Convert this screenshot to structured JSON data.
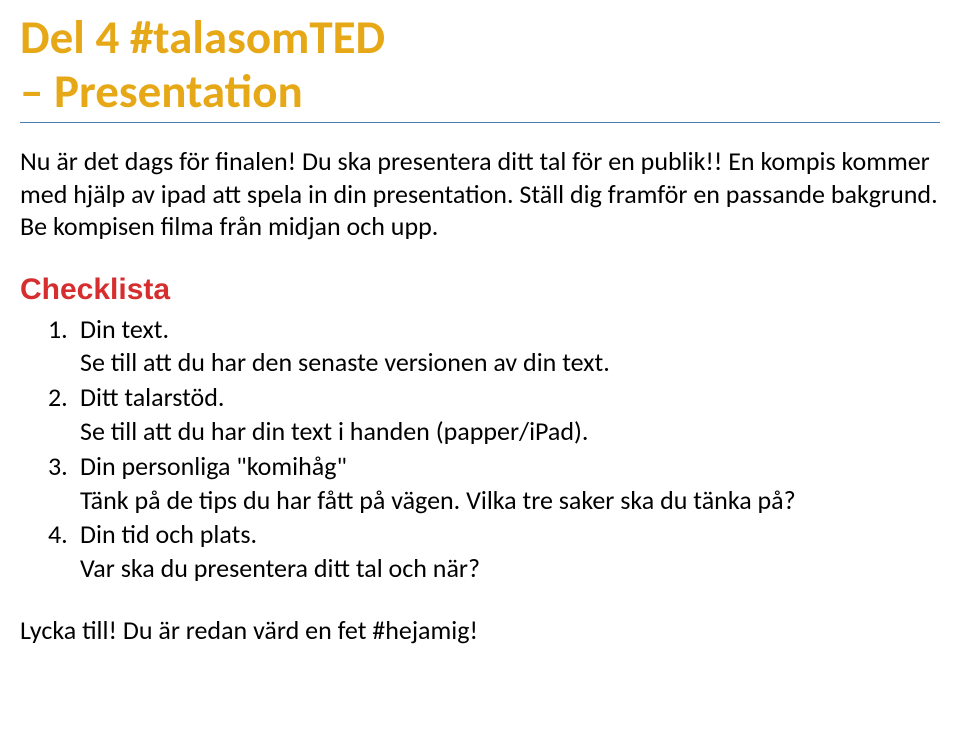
{
  "title": {
    "line1": "Del 4 #talasomTED",
    "line2": "– Presentation"
  },
  "intro": "Nu är det dags för finalen! Du ska presentera ditt tal för en publik!! En kompis kommer med hjälp av ipad att spela in din presentation. Ställ dig framför en passande bakgrund. Be kompisen filma från midjan och upp.",
  "checklist_heading": "Checklista",
  "items": [
    {
      "num": "1.",
      "label": "Din text.",
      "sub": "Se till att du har den senaste versionen av din text."
    },
    {
      "num": "2.",
      "label": "Ditt talarstöd.",
      "sub": "Se till att du har din text i handen (papper/iPad)."
    },
    {
      "num": "3.",
      "label": "Din personliga \"komihåg\"",
      "sub": "Tänk på de tips du har fått på vägen. Vilka tre saker ska du tänka på?"
    },
    {
      "num": "4.",
      "label": "Din tid och plats.",
      "sub": "Var ska du presentera ditt tal och när?"
    }
  ],
  "closing": "Lycka till! Du är redan värd en fet #hejamig!"
}
